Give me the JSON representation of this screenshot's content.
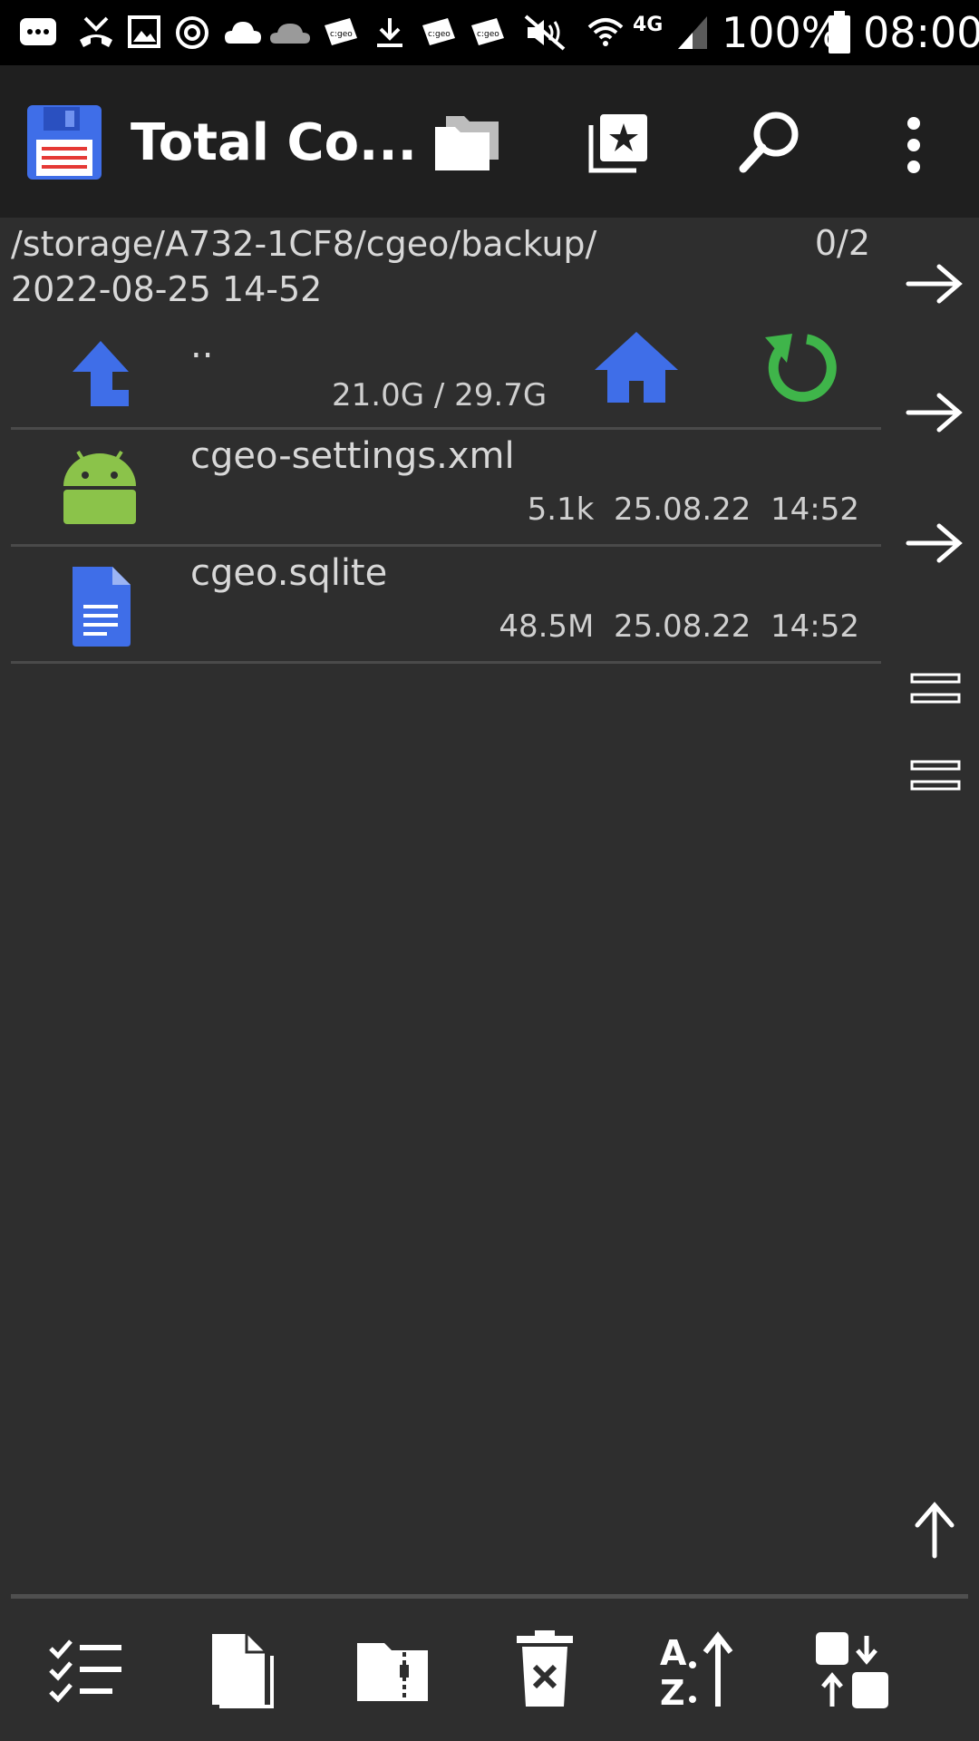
{
  "status_bar": {
    "battery": "100%",
    "time": "08:00",
    "network": "4G",
    "notification_badge": "c:geo"
  },
  "app_bar": {
    "title": "Total Co...",
    "icons": [
      "floppy-disk-app-icon",
      "folders-icon",
      "bookmark-star-icon",
      "search-icon",
      "overflow-menu-icon"
    ]
  },
  "path": {
    "line1": "/storage/A732-1CF8/cgeo/backup/",
    "line2": "2022-08-25 14-52",
    "selection_count": "0/2"
  },
  "up_row": {
    "label": "..",
    "storage": "21.0G / 29.7G"
  },
  "files": [
    {
      "name": "cgeo-settings.xml",
      "size": "5.1k",
      "date": "25.08.22",
      "time": "14:52",
      "icon": "android-icon"
    },
    {
      "name": "cgeo.sqlite",
      "size": "48.5M",
      "date": "25.08.22",
      "time": "14:52",
      "icon": "document-icon"
    }
  ],
  "side_buttons": [
    "arrow-right-icon",
    "arrow-right-icon",
    "arrow-right-icon",
    "equals-icon",
    "equals-icon",
    "arrow-up-icon"
  ],
  "bottom_toolbar": [
    "select-list-icon",
    "new-file-icon",
    "zip-folder-icon",
    "delete-icon",
    "sort-az-icon",
    "swap-panels-icon"
  ],
  "colors": {
    "background": "#2e2e2e",
    "appbar": "#1f1f1f",
    "accent_blue": "#3f6ee8",
    "refresh_green": "#3fb54a",
    "android_green": "#8bc34a"
  }
}
